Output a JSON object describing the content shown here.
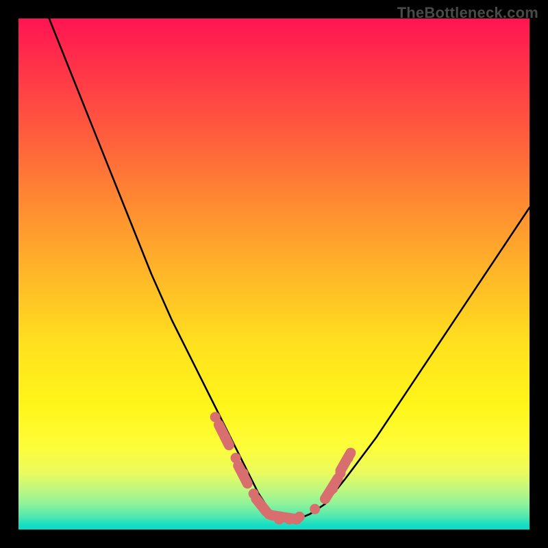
{
  "watermark": "TheBottleneck.com",
  "chart_data": {
    "type": "line",
    "title": "",
    "xlabel": "",
    "ylabel": "",
    "xlim": [
      0,
      100
    ],
    "ylim": [
      0,
      100
    ],
    "grid": false,
    "legend": false,
    "series": [
      {
        "name": "curve",
        "color": "#000000",
        "x": [
          6,
          10,
          14,
          18,
          22,
          26,
          30,
          34,
          38,
          42,
          45,
          47,
          49,
          51,
          53,
          55,
          57,
          60,
          64,
          70,
          78,
          86,
          94,
          100
        ],
        "y": [
          100,
          90,
          80,
          70,
          60,
          50,
          41,
          33,
          25,
          17,
          11,
          7,
          4,
          2.5,
          2,
          2.2,
          3,
          5,
          10,
          18,
          30,
          42,
          54,
          63
        ]
      },
      {
        "name": "dot-markers",
        "color": "#d86e6e",
        "type": "scatter",
        "x": [
          38.5,
          40.5,
          42.5,
          44,
          46,
          49,
          51,
          53,
          55,
          58,
          60,
          61.5,
          63,
          64.5
        ],
        "y": [
          22,
          18,
          14,
          11,
          7,
          3,
          2,
          2,
          2.5,
          4,
          6,
          8,
          11,
          14
        ]
      }
    ],
    "lozenge_segments": [
      {
        "x1": 39.2,
        "y1": 20.5,
        "x2": 41.2,
        "y2": 16.5
      },
      {
        "x1": 43.0,
        "y1": 12.5,
        "x2": 44.8,
        "y2": 9.0
      },
      {
        "x1": 46.5,
        "y1": 6.0,
        "x2": 48.5,
        "y2": 3.5
      },
      {
        "x1": 49.5,
        "y1": 2.8,
        "x2": 54.5,
        "y2": 2.0
      },
      {
        "x1": 60.0,
        "y1": 6.0,
        "x2": 62.5,
        "y2": 10.0
      },
      {
        "x1": 63.0,
        "y1": 11.5,
        "x2": 65.0,
        "y2": 15.0
      }
    ],
    "gradient_stops": [
      {
        "offset": 0,
        "color": "#ff1452"
      },
      {
        "offset": 0.22,
        "color": "#ff5a3e"
      },
      {
        "offset": 0.5,
        "color": "#ffb728"
      },
      {
        "offset": 0.76,
        "color": "#fff61a"
      },
      {
        "offset": 0.92,
        "color": "#c0f87e"
      },
      {
        "offset": 1.0,
        "color": "#0cd9c7"
      }
    ]
  }
}
